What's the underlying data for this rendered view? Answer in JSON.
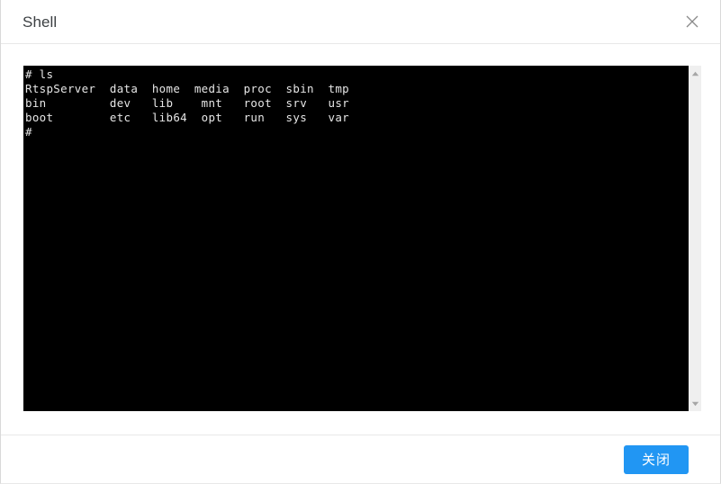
{
  "dialog": {
    "title": "Shell",
    "close_icon": "close-icon"
  },
  "terminal": {
    "text": "# ls\nRtspServer  data  home  media  proc  sbin  tmp\nbin         dev   lib    mnt   root  srv   usr\nboot        etc   lib64  opt   run   sys   var\n#",
    "background_color": "#000000",
    "foreground_color": "#e6e6e6",
    "lines": [
      "# ls",
      "RtspServer  data  home  media  proc  sbin  tmp",
      "bin         dev   lib    mnt   root  srv   usr",
      "boot        etc   lib64  opt   run   sys   var",
      "#"
    ],
    "command": "ls",
    "prompt": "#",
    "listing": [
      [
        "RtspServer",
        "data",
        "home",
        "media",
        "proc",
        "sbin",
        "tmp"
      ],
      [
        "bin",
        "dev",
        "lib",
        "mnt",
        "root",
        "srv",
        "usr"
      ],
      [
        "boot",
        "etc",
        "lib64",
        "opt",
        "run",
        "sys",
        "var"
      ]
    ]
  },
  "scrollbar": {
    "up_arrow_icon": "caret-up-icon",
    "down_arrow_icon": "caret-down-icon",
    "track_color": "#efefef"
  },
  "footer": {
    "close_button_label": "关闭",
    "close_button_color": "#2196f3"
  }
}
